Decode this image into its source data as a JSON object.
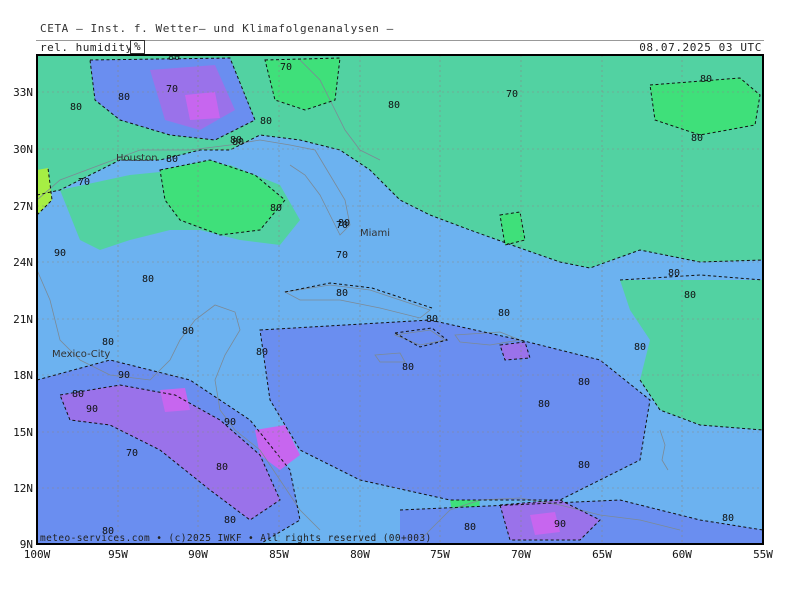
{
  "header": {
    "title": "CETA – Inst. f. Wetter– und Klimafolgenanalysen –",
    "parameter": "rel. humidity",
    "unit": "%",
    "valid_time": "08.07.2025 03 UTC"
  },
  "footer": {
    "copyright": "meteo-services.com • (c)2025 IWKF • All rights reserved (00+003)"
  },
  "map": {
    "lat_labels": [
      "33N",
      "30N",
      "27N",
      "24N",
      "21N",
      "18N",
      "15N",
      "12N",
      "9N"
    ],
    "lon_labels": [
      "100W",
      "95W",
      "90W",
      "85W",
      "80W",
      "75W",
      "70W",
      "65W",
      "60W",
      "55W"
    ],
    "places": [
      {
        "name": "Houston"
      },
      {
        "name": "Miami"
      },
      {
        "name": "Mexico-City"
      }
    ],
    "contour_labels": [
      "80",
      "80",
      "80",
      "70",
      "70",
      "80",
      "80",
      "80",
      "70",
      "80",
      "80",
      "70",
      "80",
      "80",
      "70",
      "90",
      "80",
      "80",
      "80",
      "80",
      "80",
      "80",
      "80",
      "80",
      "80",
      "90",
      "80",
      "90",
      "90",
      "70",
      "80",
      "80",
      "80",
      "80",
      "80",
      "80",
      "90",
      "80",
      "80",
      "80",
      "80",
      "80",
      "70",
      "80"
    ],
    "colors": {
      "level_60_70": "#3fe07a",
      "level_70_80": "#52d2a2",
      "level_80_90": "#6cb2f0",
      "level_90_95": "#6a8ef0",
      "level_95_100": "#9a72ea",
      "level_100": "#c766ef",
      "low_humidity": "#a6ee44",
      "frame": "#000000",
      "grid": "#888888"
    }
  }
}
